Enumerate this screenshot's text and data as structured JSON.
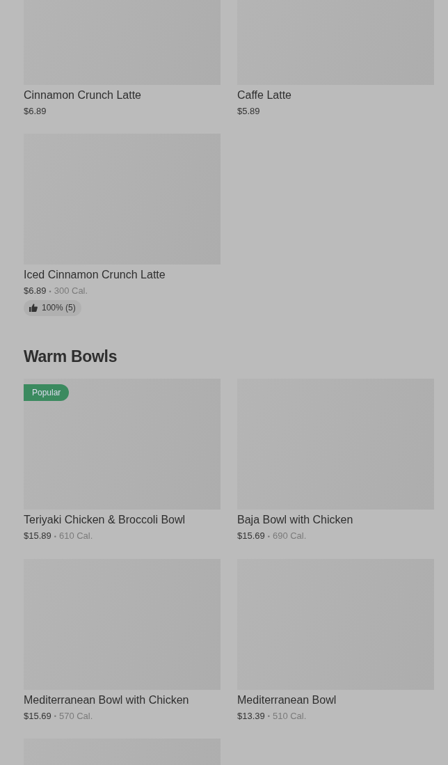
{
  "sections": [
    {
      "items": [
        {
          "kind": "dish",
          "name": "Cinnamon Crunch Latte",
          "price": "$6.89"
        },
        {
          "kind": "dish",
          "name": "Caffe Latte",
          "price": "$5.89"
        },
        {
          "kind": "dish",
          "name": "Iced Cinnamon Crunch Latte",
          "price": "$6.89",
          "separator": "•",
          "calories": "300 Cal.",
          "rating": "100% (5)"
        }
      ]
    },
    {
      "title": "Warm Bowls",
      "items": [
        {
          "kind": "dish",
          "name": "Teriyaki Chicken & Broccoli Bowl",
          "price": "$15.89",
          "separator": "•",
          "calories": "610 Cal.",
          "badge": "Popular"
        },
        {
          "kind": "dish",
          "name": "Baja Bowl with Chicken",
          "price": "$15.69",
          "separator": "•",
          "calories": "690 Cal."
        },
        {
          "kind": "dish",
          "name": "Mediterranean Bowl with Chicken",
          "price": "$15.69",
          "separator": "•",
          "calories": "570 Cal."
        },
        {
          "kind": "dish",
          "name": "Mediterranean Bowl",
          "price": "$13.39",
          "separator": "•",
          "calories": "510 Cal."
        },
        {
          "kind": "picture"
        }
      ]
    }
  ]
}
